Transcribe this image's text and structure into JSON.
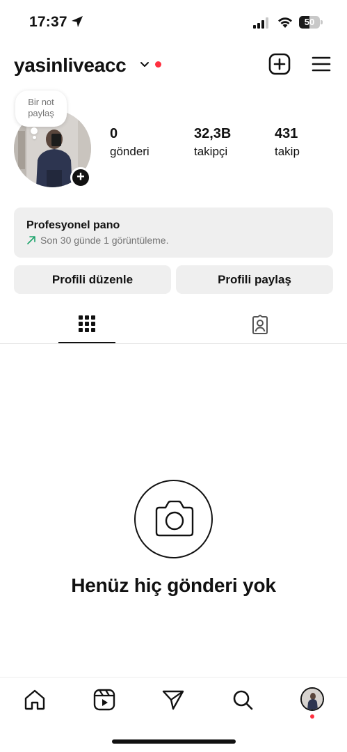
{
  "status_bar": {
    "time": "17:37",
    "battery": "50",
    "battery_level": 0.5,
    "icons": [
      "location-arrow-icon",
      "signal-icon",
      "wifi-icon",
      "battery-icon"
    ]
  },
  "header": {
    "username": "yasinliveacc",
    "icons": [
      "chevron-down-icon",
      "add-post-icon",
      "menu-icon"
    ],
    "accent": "#ff3040"
  },
  "profile": {
    "note_line1": "Bir not",
    "note_line2": "paylaş",
    "stats": [
      {
        "value": "0",
        "label": "gönderi"
      },
      {
        "value": "32,3B",
        "label": "takipçi"
      },
      {
        "value": "431",
        "label": "takip"
      }
    ]
  },
  "pro_dashboard": {
    "title": "Profesyonel pano",
    "subtitle": "Son 30 günde 1 görüntüleme.",
    "trend_color": "#1ca36b"
  },
  "actions": {
    "edit": "Profili düzenle",
    "share": "Profili paylaş"
  },
  "tabs": [
    {
      "icon": "grid-icon",
      "active": true
    },
    {
      "icon": "tagged-icon",
      "active": false
    }
  ],
  "empty_state": {
    "icon": "camera-icon",
    "title": "Henüz hiç gönderi yok"
  },
  "bottom_nav": {
    "items": [
      "home-icon",
      "reels-icon",
      "send-icon",
      "search-icon",
      "profile-avatar"
    ]
  }
}
